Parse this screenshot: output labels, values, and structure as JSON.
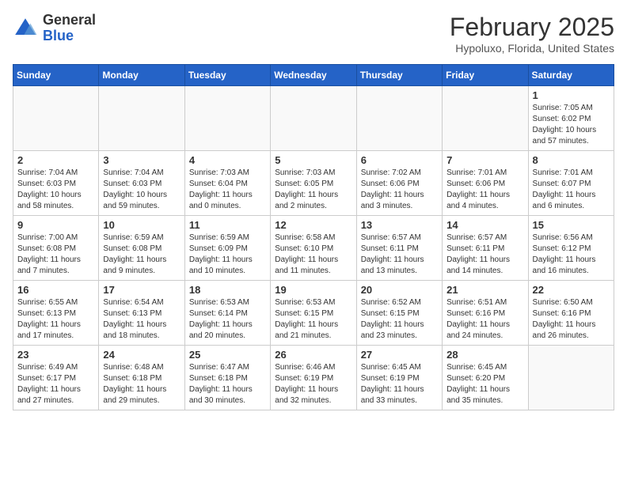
{
  "header": {
    "logo_general": "General",
    "logo_blue": "Blue",
    "month": "February 2025",
    "location": "Hypoluxo, Florida, United States"
  },
  "days_of_week": [
    "Sunday",
    "Monday",
    "Tuesday",
    "Wednesday",
    "Thursday",
    "Friday",
    "Saturday"
  ],
  "weeks": [
    [
      {
        "day": "",
        "info": ""
      },
      {
        "day": "",
        "info": ""
      },
      {
        "day": "",
        "info": ""
      },
      {
        "day": "",
        "info": ""
      },
      {
        "day": "",
        "info": ""
      },
      {
        "day": "",
        "info": ""
      },
      {
        "day": "1",
        "info": "Sunrise: 7:05 AM\nSunset: 6:02 PM\nDaylight: 10 hours and 57 minutes."
      }
    ],
    [
      {
        "day": "2",
        "info": "Sunrise: 7:04 AM\nSunset: 6:03 PM\nDaylight: 10 hours and 58 minutes."
      },
      {
        "day": "3",
        "info": "Sunrise: 7:04 AM\nSunset: 6:03 PM\nDaylight: 10 hours and 59 minutes."
      },
      {
        "day": "4",
        "info": "Sunrise: 7:03 AM\nSunset: 6:04 PM\nDaylight: 11 hours and 0 minutes."
      },
      {
        "day": "5",
        "info": "Sunrise: 7:03 AM\nSunset: 6:05 PM\nDaylight: 11 hours and 2 minutes."
      },
      {
        "day": "6",
        "info": "Sunrise: 7:02 AM\nSunset: 6:06 PM\nDaylight: 11 hours and 3 minutes."
      },
      {
        "day": "7",
        "info": "Sunrise: 7:01 AM\nSunset: 6:06 PM\nDaylight: 11 hours and 4 minutes."
      },
      {
        "day": "8",
        "info": "Sunrise: 7:01 AM\nSunset: 6:07 PM\nDaylight: 11 hours and 6 minutes."
      }
    ],
    [
      {
        "day": "9",
        "info": "Sunrise: 7:00 AM\nSunset: 6:08 PM\nDaylight: 11 hours and 7 minutes."
      },
      {
        "day": "10",
        "info": "Sunrise: 6:59 AM\nSunset: 6:08 PM\nDaylight: 11 hours and 9 minutes."
      },
      {
        "day": "11",
        "info": "Sunrise: 6:59 AM\nSunset: 6:09 PM\nDaylight: 11 hours and 10 minutes."
      },
      {
        "day": "12",
        "info": "Sunrise: 6:58 AM\nSunset: 6:10 PM\nDaylight: 11 hours and 11 minutes."
      },
      {
        "day": "13",
        "info": "Sunrise: 6:57 AM\nSunset: 6:11 PM\nDaylight: 11 hours and 13 minutes."
      },
      {
        "day": "14",
        "info": "Sunrise: 6:57 AM\nSunset: 6:11 PM\nDaylight: 11 hours and 14 minutes."
      },
      {
        "day": "15",
        "info": "Sunrise: 6:56 AM\nSunset: 6:12 PM\nDaylight: 11 hours and 16 minutes."
      }
    ],
    [
      {
        "day": "16",
        "info": "Sunrise: 6:55 AM\nSunset: 6:13 PM\nDaylight: 11 hours and 17 minutes."
      },
      {
        "day": "17",
        "info": "Sunrise: 6:54 AM\nSunset: 6:13 PM\nDaylight: 11 hours and 18 minutes."
      },
      {
        "day": "18",
        "info": "Sunrise: 6:53 AM\nSunset: 6:14 PM\nDaylight: 11 hours and 20 minutes."
      },
      {
        "day": "19",
        "info": "Sunrise: 6:53 AM\nSunset: 6:15 PM\nDaylight: 11 hours and 21 minutes."
      },
      {
        "day": "20",
        "info": "Sunrise: 6:52 AM\nSunset: 6:15 PM\nDaylight: 11 hours and 23 minutes."
      },
      {
        "day": "21",
        "info": "Sunrise: 6:51 AM\nSunset: 6:16 PM\nDaylight: 11 hours and 24 minutes."
      },
      {
        "day": "22",
        "info": "Sunrise: 6:50 AM\nSunset: 6:16 PM\nDaylight: 11 hours and 26 minutes."
      }
    ],
    [
      {
        "day": "23",
        "info": "Sunrise: 6:49 AM\nSunset: 6:17 PM\nDaylight: 11 hours and 27 minutes."
      },
      {
        "day": "24",
        "info": "Sunrise: 6:48 AM\nSunset: 6:18 PM\nDaylight: 11 hours and 29 minutes."
      },
      {
        "day": "25",
        "info": "Sunrise: 6:47 AM\nSunset: 6:18 PM\nDaylight: 11 hours and 30 minutes."
      },
      {
        "day": "26",
        "info": "Sunrise: 6:46 AM\nSunset: 6:19 PM\nDaylight: 11 hours and 32 minutes."
      },
      {
        "day": "27",
        "info": "Sunrise: 6:45 AM\nSunset: 6:19 PM\nDaylight: 11 hours and 33 minutes."
      },
      {
        "day": "28",
        "info": "Sunrise: 6:45 AM\nSunset: 6:20 PM\nDaylight: 11 hours and 35 minutes."
      },
      {
        "day": "",
        "info": ""
      }
    ]
  ]
}
